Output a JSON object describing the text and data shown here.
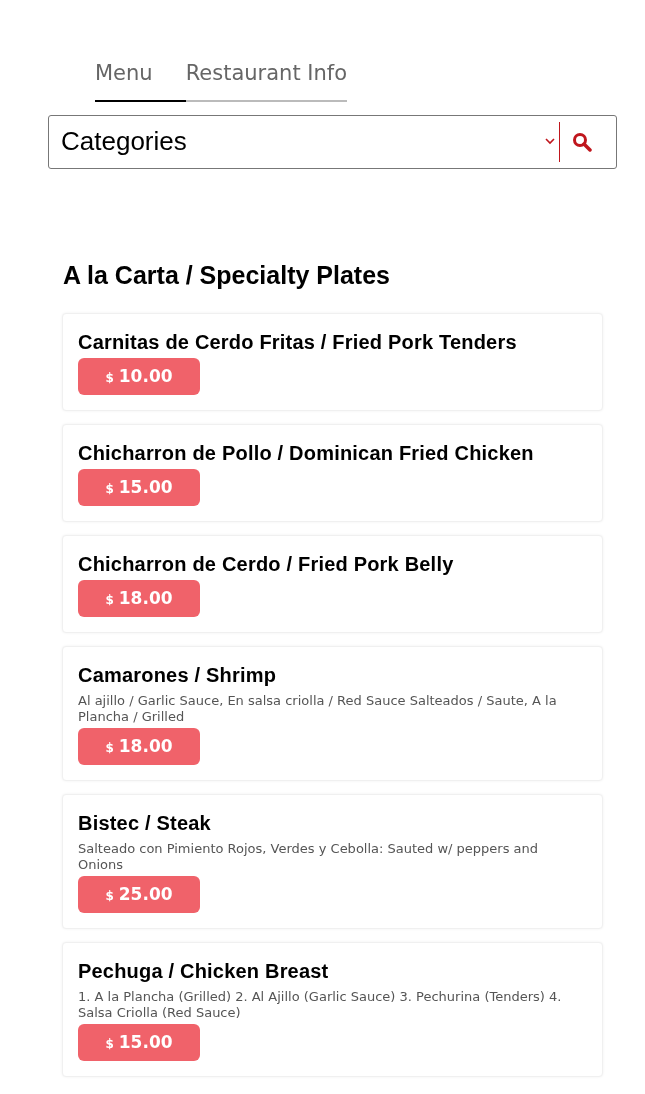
{
  "tabs": [
    {
      "label": "Menu",
      "selected": true
    },
    {
      "label": "Restaurant Info",
      "selected": false
    }
  ],
  "category_select": {
    "value": "Categories"
  },
  "section": {
    "title": "A la Carta / Specialty Plates",
    "items": [
      {
        "name": "Carnitas de Cerdo Fritas / Fried Pork Tenders",
        "currency": "$",
        "price": "10.00"
      },
      {
        "name": "Chicharron de Pollo / Dominican Fried Chicken",
        "currency": "$",
        "price": "15.00"
      },
      {
        "name": "Chicharron de Cerdo / Fried Pork Belly",
        "currency": "$",
        "price": "18.00"
      },
      {
        "name": "Camarones / Shrimp",
        "description": "Al ajillo / Garlic Sauce, En salsa criolla / Red Sauce Salteados / Saute, A la Plancha / Grilled",
        "currency": "$",
        "price": "18.00"
      },
      {
        "name": "Bistec / Steak",
        "description": "Salteado con Pimiento Rojos, Verdes y Cebolla: Sauted w/ peppers and Onions",
        "currency": "$",
        "price": "25.00"
      },
      {
        "name": "Pechuga / Chicken Breast",
        "description": "1. A la Plancha (Grilled) 2. Al Ajillo (Garlic Sauce) 3. Pechurina (Tenders) 4. Salsa Criolla (Red Sauce)",
        "currency": "$",
        "price": "15.00"
      }
    ]
  }
}
